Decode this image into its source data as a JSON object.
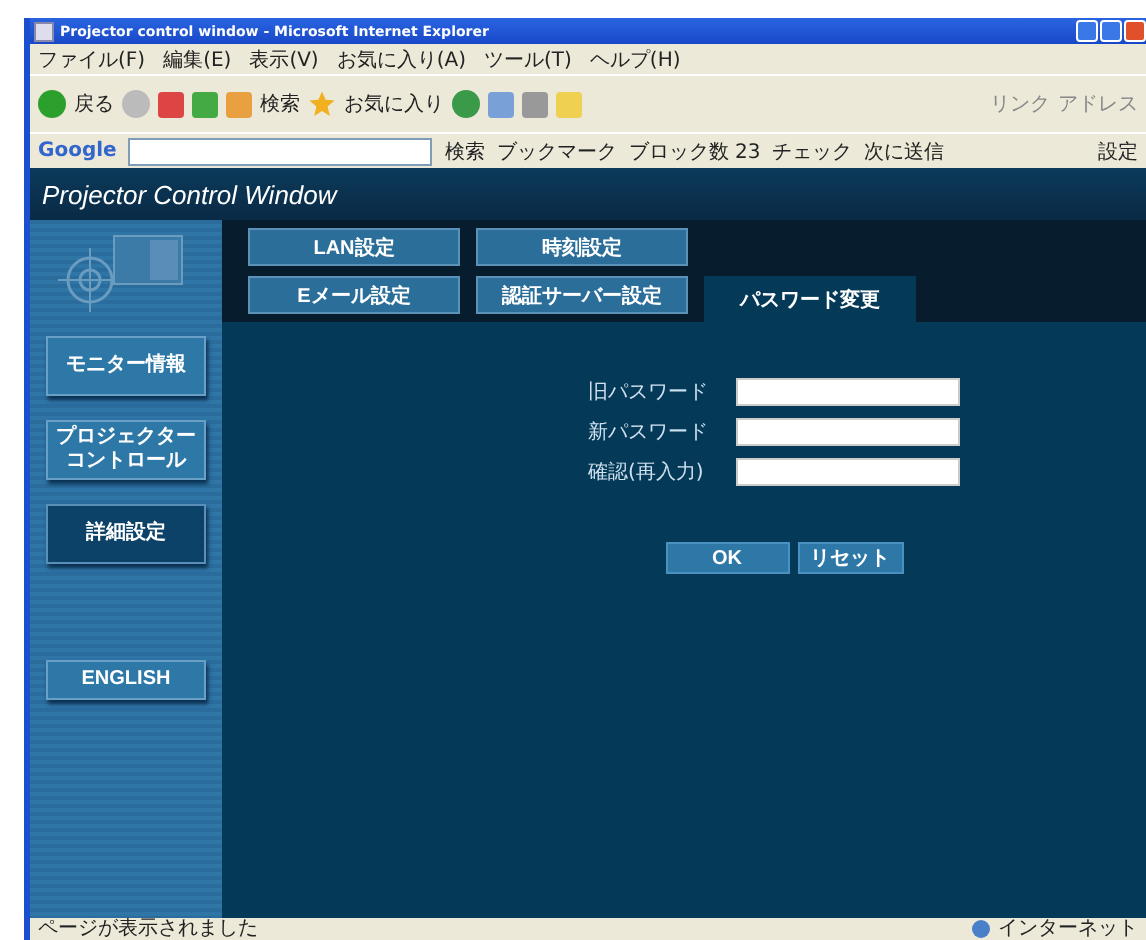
{
  "window": {
    "title": "Projector control window - Microsoft Internet Explorer"
  },
  "menu": [
    "ファイル(F)",
    "編集(E)",
    "表示(V)",
    "お気に入り(A)",
    "ツール(T)",
    "ヘルプ(H)"
  ],
  "toolbar": {
    "back": "戻る",
    "search": "検索",
    "favorites": "お気に入り",
    "links": "リンク",
    "address": "アドレス"
  },
  "google_bar": {
    "logo": "Google",
    "search": "検索",
    "bookmarks": "ブックマーク",
    "blocked": "ブロック数 23",
    "check": "チェック",
    "send": "次に送信",
    "settings": "設定"
  },
  "app": {
    "title": "Projector Control Window"
  },
  "sidebar": [
    {
      "label": "モニター情報",
      "selected": false
    },
    {
      "label": "プロジェクターコントロール",
      "selected": false
    },
    {
      "label": "詳細設定",
      "selected": true
    },
    {
      "label": "ENGLISH",
      "selected": false
    }
  ],
  "tab_rows": [
    [
      {
        "label": "LAN設定",
        "selected": false
      },
      {
        "label": "時刻設定",
        "selected": false
      }
    ],
    [
      {
        "label": "Eメール設定",
        "selected": false
      },
      {
        "label": "認証サーバー設定",
        "selected": false
      },
      {
        "label": "パスワード変更",
        "selected": true
      }
    ]
  ],
  "form": {
    "fields": [
      {
        "label": "旧パスワード"
      },
      {
        "label": "新パスワード"
      },
      {
        "label": "確認(再入力)"
      }
    ],
    "buttons": [
      "OK",
      "リセット"
    ]
  },
  "status_bar": {
    "message": "ページが表示されました",
    "zone": "インターネット"
  }
}
